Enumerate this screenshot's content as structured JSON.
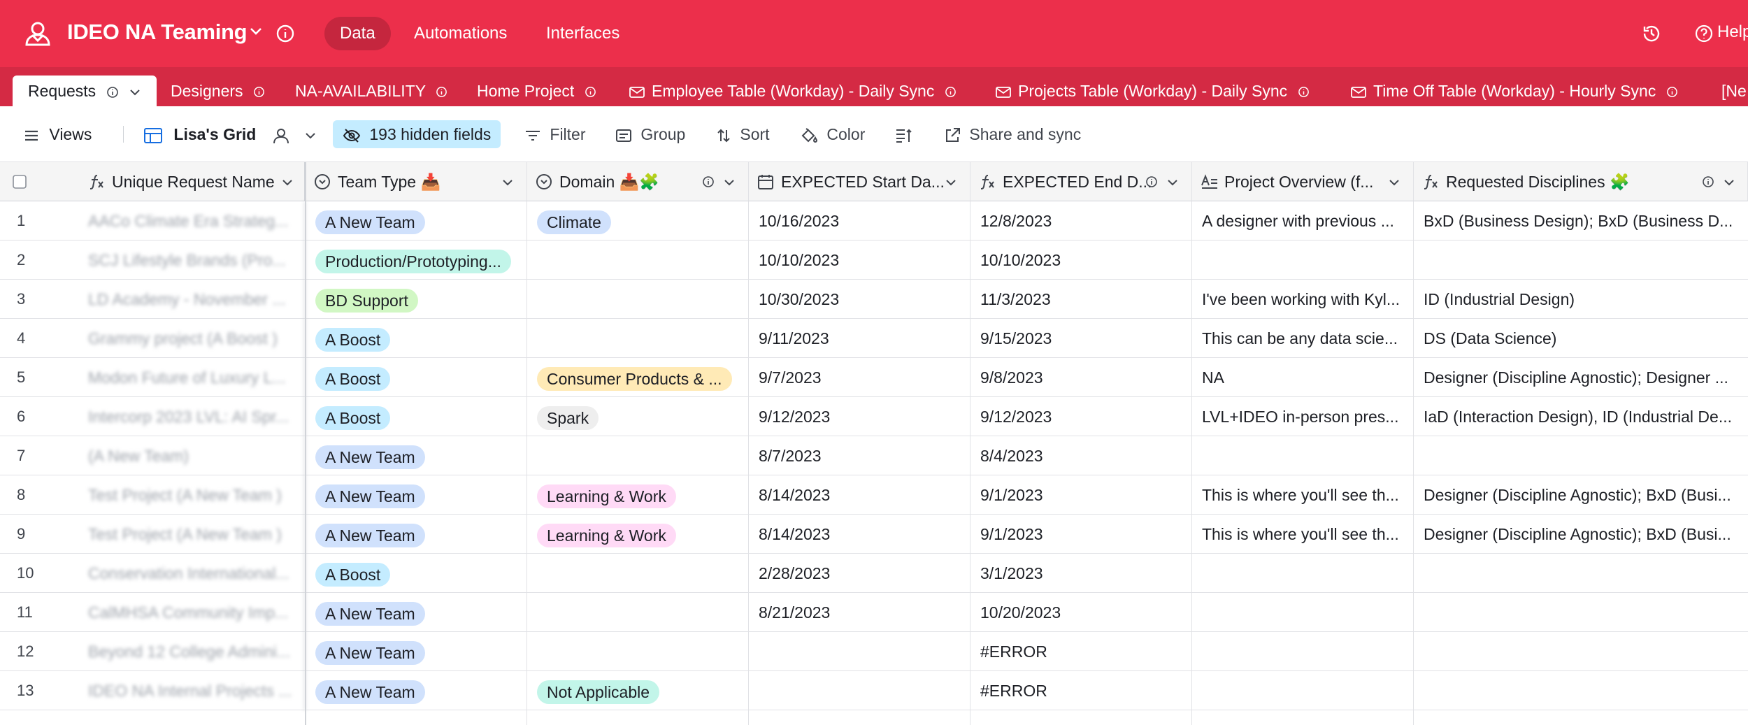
{
  "app": {
    "base_name": "IDEO NA Teaming",
    "nav": [
      {
        "label": "Data",
        "active": true
      },
      {
        "label": "Automations",
        "active": false
      },
      {
        "label": "Interfaces",
        "active": false
      }
    ],
    "help_label": "Help"
  },
  "tabs": [
    {
      "label": "Requests",
      "active": true
    },
    {
      "label": "Designers"
    },
    {
      "label": "NA-AVAILABILITY"
    },
    {
      "label": "Home Project"
    },
    {
      "label": "Employee Table (Workday) - Daily Sync",
      "synced": true
    },
    {
      "label": "Projects Table (Workday) - Daily Sync",
      "synced": true
    },
    {
      "label": "Time Off Table (Workday) - Hourly Sync",
      "synced": true
    },
    {
      "label": "[Ne"
    }
  ],
  "toolbar": {
    "views_label": "Views",
    "view_name": "Lisa's Grid",
    "hidden_fields": "193 hidden fields",
    "filter": "Filter",
    "group": "Group",
    "sort": "Sort",
    "color": "Color",
    "share": "Share and sync"
  },
  "columns": [
    {
      "label": "Unique Request Name",
      "icon": "formula-icon"
    },
    {
      "label": "Team Type 📥",
      "icon": "single-select-icon"
    },
    {
      "label": "Domain 📥🧩",
      "icon": "single-select-icon"
    },
    {
      "label": "EXPECTED Start Da...",
      "icon": "calendar-icon"
    },
    {
      "label": "EXPECTED End D...",
      "icon": "formula-icon"
    },
    {
      "label": "Project Overview (f...",
      "icon": "long-text-icon"
    },
    {
      "label": "Requested Disciplines 🧩",
      "icon": "formula-icon"
    }
  ],
  "rows": [
    {
      "n": "1",
      "name": "AACo Climate Era Strateg...",
      "team": "A New Team",
      "team_color": "blue",
      "domain": "Climate",
      "domain_color": "blue",
      "start": "10/16/2023",
      "end": "12/8/2023",
      "overview": "A designer with previous ...",
      "disciplines": "BxD (Business Design); BxD (Business D..."
    },
    {
      "n": "2",
      "name": "SCJ Lifestyle Brands (Pro...",
      "team": "Production/Prototyping...",
      "team_color": "teal",
      "domain": "",
      "domain_color": "",
      "start": "10/10/2023",
      "end": "10/10/2023",
      "overview": "",
      "disciplines": ""
    },
    {
      "n": "3",
      "name": "LD Academy - November ...",
      "team": "BD Support",
      "team_color": "green",
      "domain": "",
      "domain_color": "",
      "start": "10/30/2023",
      "end": "11/3/2023",
      "overview": "I've been working with Kyl...",
      "disciplines": "ID (Industrial Design)"
    },
    {
      "n": "4",
      "name": "Grammy project (A Boost )",
      "team": "A Boost",
      "team_color": "cyan",
      "domain": "",
      "domain_color": "",
      "start": "9/11/2023",
      "end": "9/15/2023",
      "overview": "This can be any data scie...",
      "disciplines": "DS (Data Science)"
    },
    {
      "n": "5",
      "name": "Modon Future of Luxury L...",
      "team": "A Boost",
      "team_color": "cyan",
      "domain": "Consumer Products & ...",
      "domain_color": "yellow",
      "start": "9/7/2023",
      "end": "9/8/2023",
      "overview": "NA",
      "disciplines": "Designer (Discipline Agnostic); Designer ..."
    },
    {
      "n": "6",
      "name": "Intercorp 2023 LVL: AI Spr...",
      "team": "A Boost",
      "team_color": "cyan",
      "domain": "Spark",
      "domain_color": "gray",
      "start": "9/12/2023",
      "end": "9/12/2023",
      "overview": "LVL+IDEO in-person pres...",
      "disciplines": "IaD (Interaction Design), ID (Industrial De..."
    },
    {
      "n": "7",
      "name": "(A New Team)",
      "team": "A New Team",
      "team_color": "blue",
      "domain": "",
      "domain_color": "",
      "start": "8/7/2023",
      "end": "8/4/2023",
      "overview": "",
      "disciplines": ""
    },
    {
      "n": "8",
      "name": "Test Project (A New Team )",
      "team": "A New Team",
      "team_color": "blue",
      "domain": "Learning & Work",
      "domain_color": "pink",
      "start": "8/14/2023",
      "end": "9/1/2023",
      "overview": "This is where you'll see th...",
      "disciplines": "Designer (Discipline Agnostic); BxD (Busi..."
    },
    {
      "n": "9",
      "name": "Test Project (A New Team )",
      "team": "A New Team",
      "team_color": "blue",
      "domain": "Learning & Work",
      "domain_color": "pink",
      "start": "8/14/2023",
      "end": "9/1/2023",
      "overview": "This is where you'll see th...",
      "disciplines": "Designer (Discipline Agnostic); BxD (Busi..."
    },
    {
      "n": "10",
      "name": "Conservation International...",
      "team": "A Boost",
      "team_color": "cyan",
      "domain": "",
      "domain_color": "",
      "start": "2/28/2023",
      "end": "3/1/2023",
      "overview": "",
      "disciplines": ""
    },
    {
      "n": "11",
      "name": "CalMHSA Community Imp...",
      "team": "A New Team",
      "team_color": "blue",
      "domain": "",
      "domain_color": "",
      "start": "8/21/2023",
      "end": "10/20/2023",
      "overview": "",
      "disciplines": ""
    },
    {
      "n": "12",
      "name": "Beyond 12 College Admini...",
      "team": "A New Team",
      "team_color": "blue",
      "domain": "",
      "domain_color": "",
      "start": "",
      "end": "#ERROR",
      "overview": "",
      "disciplines": ""
    },
    {
      "n": "13",
      "name": "IDEO NA Internal Projects ...",
      "team": "A New Team",
      "team_color": "blue",
      "domain": "Not Applicable",
      "domain_color": "mint",
      "start": "",
      "end": "#ERROR",
      "overview": "",
      "disciplines": ""
    }
  ]
}
